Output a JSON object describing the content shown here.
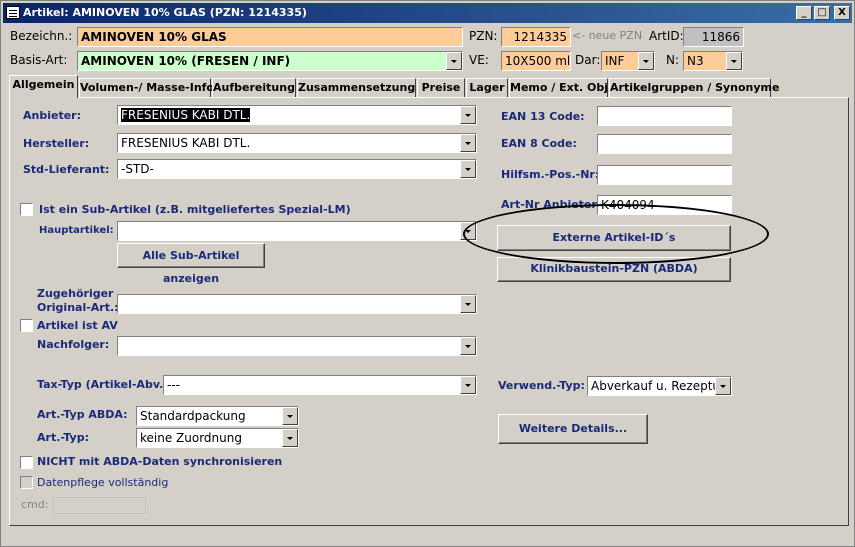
{
  "window": {
    "title": "Artikel: AMINOVEN 10% GLAS (PZN: 1214335)",
    "controls": {
      "minimize": "_",
      "maximize": "□",
      "close": "X"
    }
  },
  "header": {
    "bezeichn_label": "Bezeichn.:",
    "bezeichn_value": "AMINOVEN 10% GLAS",
    "pzn_label": "PZN:",
    "pzn_value": "1214335",
    "neue_pzn_label": "<- neue PZN",
    "artid_label": "ArtID:",
    "artid_value": "11866",
    "basis_label": "Basis-Art:",
    "basis_value": "AMINOVEN 10% (FRESEN / INF)",
    "ve_label": "VE:",
    "ve_value": "10X500 ml",
    "dar_label": "Dar:",
    "dar_value": "INF",
    "n_label": "N:",
    "n_value": "N3"
  },
  "tabs": [
    "Allgemein",
    "Volumen-/ Masse-Info",
    "Aufbereitung",
    "Zusammensetzung",
    "Preise",
    "Lager",
    "Memo / Ext. Obj.",
    "Artikelgruppen / Synonyme"
  ],
  "form": {
    "anbieter_label": "Anbieter:",
    "anbieter_value": "FRESENIUS KABI DTL.",
    "hersteller_label": "Hersteller:",
    "hersteller_value": "FRESENIUS KABI DTL.",
    "stdlief_label": "Std-Lieferant:",
    "stdlief_value": "-STD-",
    "sub_artikel_label": "Ist ein Sub-Artikel (z.B. mitgeliefertes Spezial-LM)",
    "hauptartikel_label": "Hauptartikel:",
    "hauptartikel_value": "",
    "alle_sub_button": "Alle Sub-Artikel anzeigen",
    "zugehoeriger_label_1": "Zugehöriger",
    "zugehoeriger_label_2": "Original-Art.:",
    "zugehoeriger_value": "",
    "artikel_av_label": "Artikel ist AV",
    "nachfolger_label": "Nachfolger:",
    "nachfolger_value": "",
    "taxtyp_label": "Tax-Typ (Artikel-Abv.):",
    "taxtyp_value": "---",
    "arttyp_abda_label": "Art.-Typ ABDA:",
    "arttyp_abda_value": "Standardpackung",
    "arttyp_label": "Art.-Typ:",
    "arttyp_value": "keine Zuordnung",
    "nicht_abda_label": "NICHT mit ABDA-Daten synchronisieren",
    "datenpflege_label": "Datenpflege vollständig",
    "cmd_label": "cmd:",
    "cmd_value": "",
    "ean13_label": "EAN 13 Code:",
    "ean13_value": "",
    "ean8_label": "EAN 8 Code:",
    "ean8_value": "",
    "hilfsm_label": "Hilfsm.-Pos.-Nr:",
    "hilfsm_value": "",
    "artnr_anbieter_label": "Art-Nr Anbieter:",
    "artnr_anbieter_value": "K404094",
    "externe_button": "Externe Artikel-ID´s",
    "klinik_button": "Klinikbaustein-PZN (ABDA)",
    "verwend_label": "Verwend.-Typ:",
    "verwend_value": "Abverkauf u. Rezeptur",
    "weitere_button": "Weitere Details..."
  },
  "colors": {
    "title_start": "#0a246a",
    "title_end": "#3a6ea5",
    "bezeichn_bg": "#ffcc99",
    "basis_bg": "#ccffcc",
    "pzn_bg": "#ffcc99",
    "artid_bg": "#c0c0c0",
    "label_blue": "#1a2a7a"
  }
}
